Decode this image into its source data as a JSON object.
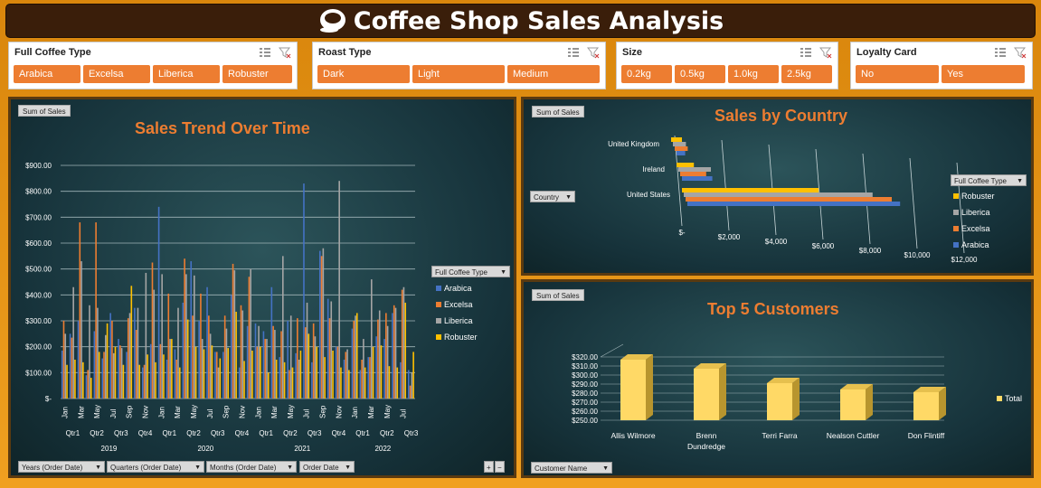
{
  "title": "Coffee Shop Sales Analysis",
  "colors": {
    "arabica": "#4472c4",
    "excelsa": "#ed7d31",
    "liberica": "#a5a5a5",
    "robuster": "#ffc000",
    "accent": "#ed7d31",
    "total": "#ffd966"
  },
  "slicers": [
    {
      "title": "Full Coffee Type",
      "items": [
        "Arabica",
        "Excelsa",
        "Liberica",
        "Robuster"
      ]
    },
    {
      "title": "Roast Type",
      "items": [
        "Dark",
        "Light",
        "Medium"
      ]
    },
    {
      "title": "Size",
      "items": [
        "0.2kg",
        "0.5kg",
        "1.0kg",
        "2.5kg"
      ]
    },
    {
      "title": "Loyalty Card",
      "items": [
        "No",
        "Yes"
      ]
    }
  ],
  "trend": {
    "tag": "Sum of Sales",
    "title": "Sales Trend Over Time",
    "legend_title": "Full Coffee Type",
    "series": [
      "Arabica",
      "Excelsa",
      "Liberica",
      "Robuster"
    ],
    "yticks": [
      "$-",
      "$100.00",
      "$200.00",
      "$300.00",
      "$400.00",
      "$500.00",
      "$600.00",
      "$700.00",
      "$800.00",
      "$900.00"
    ],
    "month_labels": [
      "Jan",
      "Mar",
      "May",
      "Jul",
      "Sep",
      "Nov",
      "Jan",
      "Mar",
      "May",
      "Jul",
      "Sep",
      "Nov",
      "Jan",
      "Mar",
      "May",
      "Jul",
      "Sep",
      "Nov",
      "Jan",
      "Mar",
      "May",
      "Jul"
    ],
    "quarter_labels": [
      "Qtr1",
      "Qtr2",
      "Qtr3",
      "Qtr4",
      "Qtr1",
      "Qtr2",
      "Qtr3",
      "Qtr4",
      "Qtr1",
      "Qtr2",
      "Qtr3",
      "Qtr4",
      "Qtr1",
      "Qtr2",
      "Qtr3"
    ],
    "years": [
      "2019",
      "2020",
      "2021",
      "2022"
    ],
    "filters": [
      "Years (Order Date)",
      "Quarters (Order Date)",
      "Months (Order Date)",
      "Order Date"
    ],
    "plus": "+",
    "minus": "−"
  },
  "country": {
    "tag": "Sum of Sales",
    "title": "Sales by Country",
    "filter": "Country",
    "legend_title": "Full Coffee Type",
    "legend": [
      "Robuster",
      "Liberica",
      "Excelsa",
      "Arabica"
    ],
    "xticks": [
      "$-",
      "$2,000",
      "$4,000",
      "$6,000",
      "$8,000",
      "$10,000",
      "$12,000"
    ]
  },
  "customers": {
    "tag": "Sum of Sales",
    "title": "Top  5 Customers",
    "filter": "Customer Name",
    "legend": "Total",
    "yticks": [
      "$250.00",
      "$260.00",
      "$270.00",
      "$280.00",
      "$290.00",
      "$300.00",
      "$310.00",
      "$320.00"
    ]
  },
  "chart_data": [
    {
      "type": "bar",
      "title": "Sales Trend Over Time",
      "ylim": [
        0,
        900
      ],
      "categories": [
        "2019-01",
        "2019-02",
        "2019-03",
        "2019-04",
        "2019-05",
        "2019-06",
        "2019-07",
        "2019-08",
        "2019-09",
        "2019-10",
        "2019-11",
        "2019-12",
        "2020-01",
        "2020-02",
        "2020-03",
        "2020-04",
        "2020-05",
        "2020-06",
        "2020-07",
        "2020-08",
        "2020-09",
        "2020-10",
        "2020-11",
        "2020-12",
        "2021-01",
        "2021-02",
        "2021-03",
        "2021-04",
        "2021-05",
        "2021-06",
        "2021-07",
        "2021-08",
        "2021-09",
        "2021-10",
        "2021-11",
        "2021-12",
        "2022-01",
        "2022-02",
        "2022-03",
        "2022-04",
        "2022-05",
        "2022-06",
        "2022-07",
        "2022-08"
      ],
      "series": [
        {
          "name": "Arabica",
          "values": [
            185,
            250,
            300,
            90,
            260,
            155,
            330,
            230,
            180,
            350,
            120,
            210,
            740,
            150,
            190,
            370,
            530,
            300,
            430,
            180,
            180,
            400,
            120,
            280,
            290,
            260,
            430,
            160,
            300,
            175,
            830,
            140,
            570,
            385,
            200,
            150,
            270,
            110,
            160,
            240,
            230,
            330,
            140,
            110
          ]
        },
        {
          "name": "Excelsa",
          "values": [
            300,
            235,
            680,
            110,
            680,
            180,
            300,
            205,
            310,
            265,
            130,
            525,
            210,
            405,
            150,
            540,
            320,
            405,
            320,
            180,
            320,
            520,
            360,
            470,
            200,
            230,
            280,
            260,
            110,
            310,
            275,
            290,
            550,
            310,
            200,
            180,
            300,
            150,
            160,
            305,
            330,
            360,
            420,
            50
          ]
        },
        {
          "name": "Liberica",
          "values": [
            250,
            430,
            530,
            360,
            350,
            245,
            175,
            195,
            330,
            350,
            485,
            420,
            480,
            230,
            350,
            480,
            475,
            230,
            250,
            120,
            270,
            495,
            340,
            500,
            280,
            230,
            265,
            550,
            320,
            150,
            370,
            240,
            580,
            375,
            840,
            190,
            320,
            230,
            460,
            340,
            280,
            350,
            430,
            100
          ]
        },
        {
          "name": "Robuster",
          "values": [
            130,
            150,
            140,
            80,
            180,
            290,
            200,
            130,
            435,
            130,
            170,
            140,
            170,
            230,
            120,
            305,
            200,
            190,
            205,
            155,
            195,
            335,
            145,
            185,
            200,
            100,
            150,
            140,
            120,
            185,
            250,
            200,
            160,
            185,
            120,
            110,
            330,
            120,
            200,
            205,
            125,
            120,
            370,
            180
          ]
        }
      ]
    },
    {
      "type": "bar",
      "title": "Sales by Country",
      "categories": [
        "United States",
        "Ireland",
        "United Kingdom"
      ],
      "xlim": [
        0,
        12000
      ],
      "series": [
        {
          "name": "Robuster",
          "values": [
            6300,
            800,
            500
          ]
        },
        {
          "name": "Liberica",
          "values": [
            8700,
            1500,
            600
          ]
        },
        {
          "name": "Excelsa",
          "values": [
            9500,
            1200,
            600
          ]
        },
        {
          "name": "Arabica",
          "values": [
            9800,
            1400,
            400
          ]
        }
      ]
    },
    {
      "type": "bar",
      "title": "Top  5 Customers",
      "categories": [
        "Allis Wilmore",
        "Brenn Dundredge",
        "Terri Farra",
        "Nealson Cuttler",
        "Don Flintiff"
      ],
      "ylim": [
        250,
        320
      ],
      "series": [
        {
          "name": "Total",
          "values": [
            317,
            307,
            291,
            284,
            281
          ]
        }
      ]
    }
  ]
}
